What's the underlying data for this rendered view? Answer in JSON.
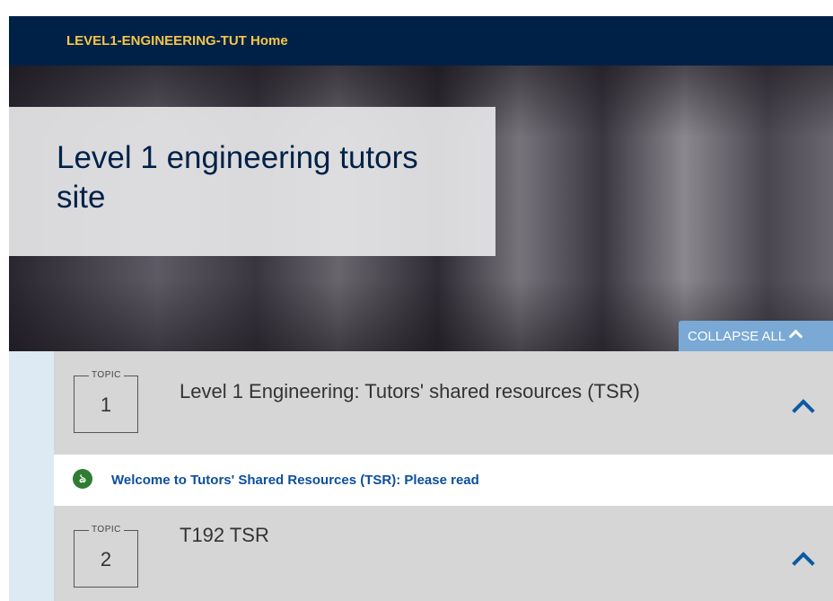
{
  "header": {
    "home_label": "LEVEL1-ENGINEERING-TUT Home"
  },
  "banner": {
    "title": "Level 1 engineering tutors site"
  },
  "collapse_all": {
    "label": "COLLAPSE ALL"
  },
  "topics": [
    {
      "tag": "TOPIC",
      "number": "1",
      "title": "Level 1 Engineering: Tutors' shared resources (TSR)"
    },
    {
      "tag": "TOPIC",
      "number": "2",
      "title": "T192 TSR"
    }
  ],
  "activity": {
    "icon": "award-icon",
    "label": "Welcome to Tutors' Shared Resources (TSR): Please read"
  },
  "colors": {
    "header_bg": "#002147",
    "home_link": "#f4c74a",
    "topic_bg": "#d6d6d6",
    "link": "#0b4f9c",
    "collapse_bg": "#79a9d4",
    "badge": "#2e7d32"
  }
}
